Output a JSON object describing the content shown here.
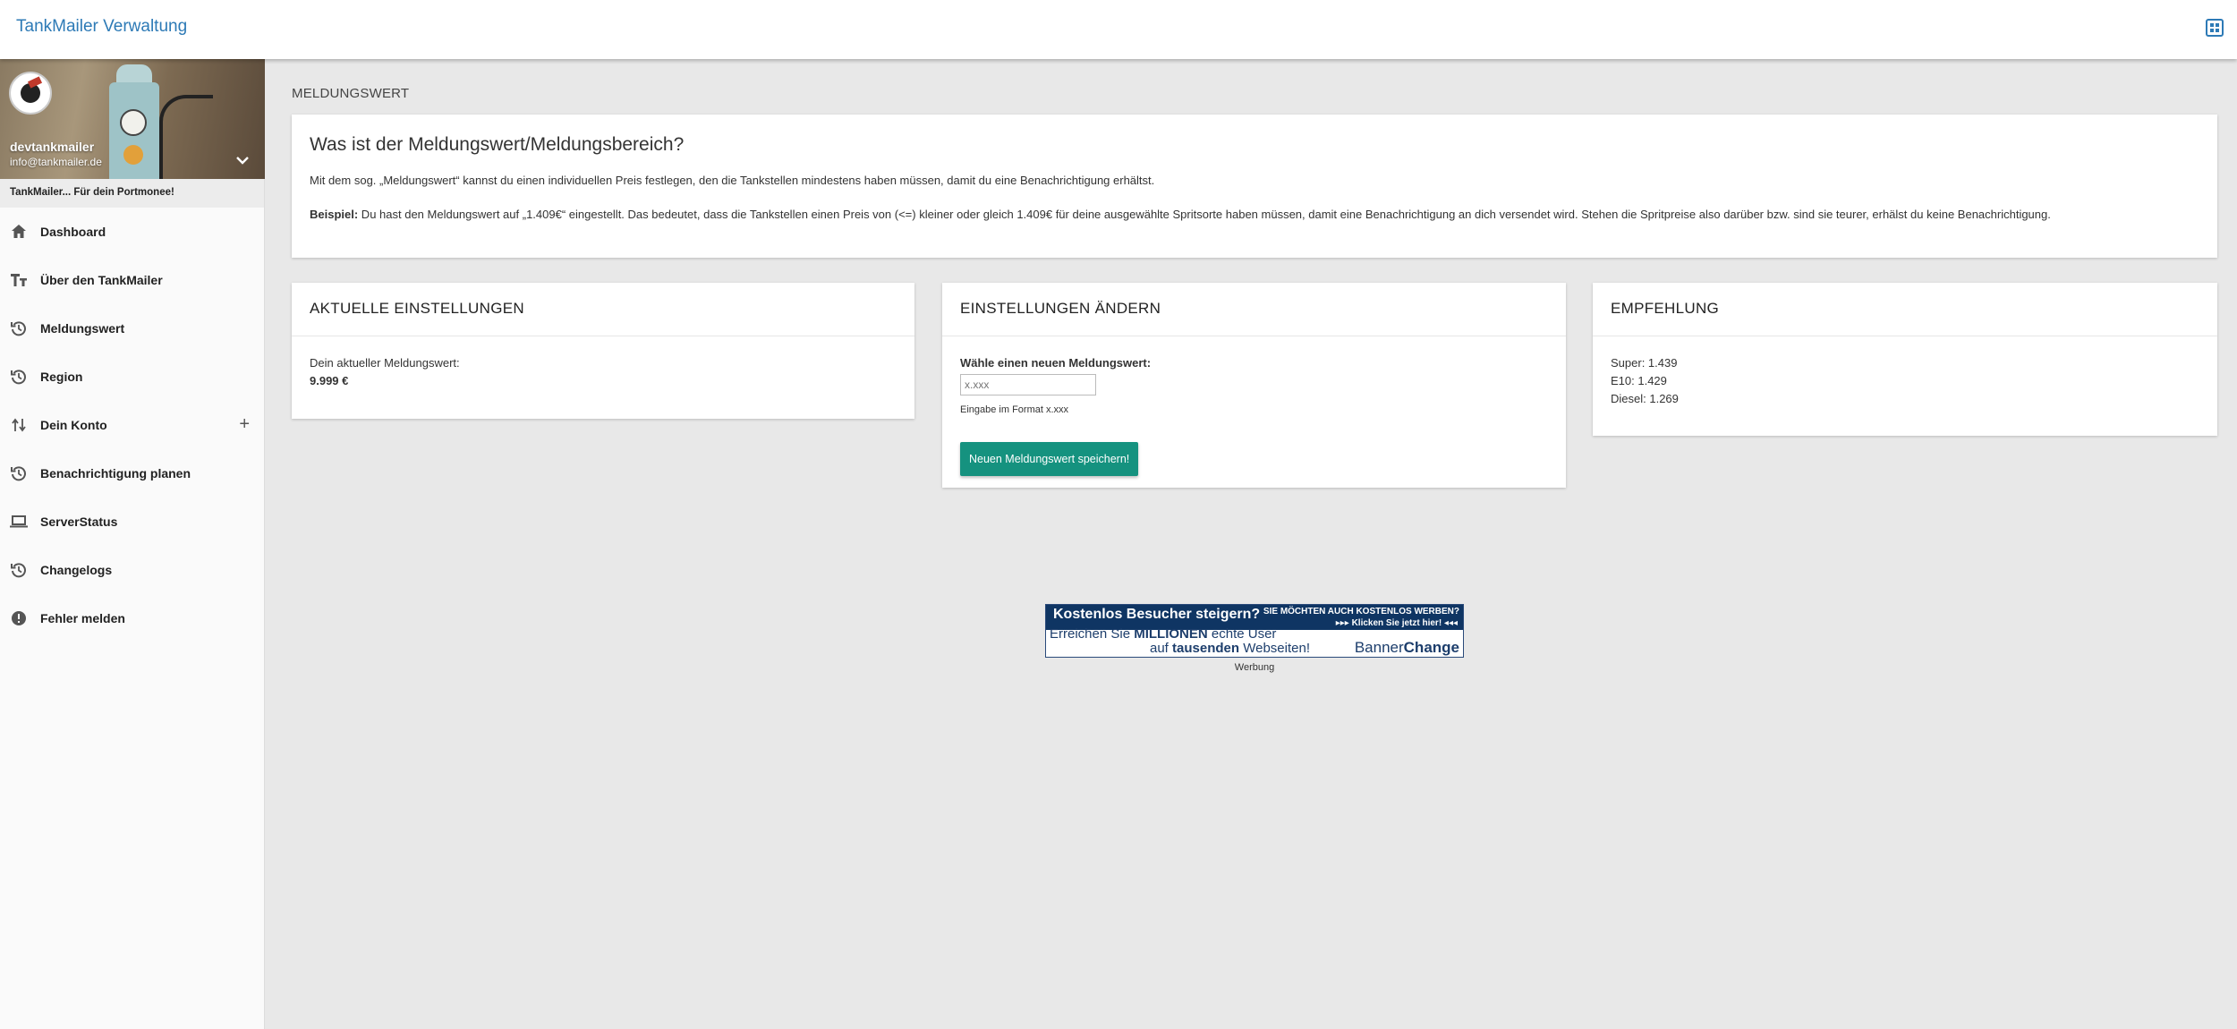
{
  "app": {
    "title": "TankMailer Verwaltung"
  },
  "profile": {
    "username": "devtankmailer",
    "email": "info@tankmailer.de",
    "slogan": "TankMailer... Für dein Portmonee!"
  },
  "sidebar": {
    "items": [
      {
        "label": "Dashboard",
        "icon": "home-icon"
      },
      {
        "label": "Über den TankMailer",
        "icon": "text-icon"
      },
      {
        "label": "Meldungswert",
        "icon": "history-icon"
      },
      {
        "label": "Region",
        "icon": "history-icon"
      },
      {
        "label": "Dein Konto",
        "icon": "swap-icon",
        "expand": "+"
      },
      {
        "label": "Benachrichtigung planen",
        "icon": "history-icon"
      },
      {
        "label": "ServerStatus",
        "icon": "laptop-icon"
      },
      {
        "label": "Changelogs",
        "icon": "history-icon"
      },
      {
        "label": "Fehler melden",
        "icon": "alert-icon"
      }
    ]
  },
  "page": {
    "breadcrumb": "MELDUNGSWERT",
    "intro": {
      "title": "Was ist der Meldungswert/Meldungsbereich?",
      "paragraph1": "Mit dem sog. „Meldungswert“ kannst du einen individuellen Preis festlegen, den die Tankstellen mindestens haben müssen, damit du eine Benachrichtigung erhältst.",
      "example_label": "Beispiel:",
      "example_text": " Du hast den Meldungswert auf „1.409€“ eingestellt. Das bedeutet, dass die Tankstellen einen Preis von (<=) kleiner oder gleich 1.409€ für deine ausgewählte Spritsorte haben müssen, damit eine Benachrichtigung an dich versendet wird. Stehen die Spritpreise also darüber bzw. sind sie teurer, erhälst du keine Benachrichtigung."
    },
    "current": {
      "title": "AKTUELLE EINSTELLUNGEN",
      "label": "Dein aktueller Meldungswert:",
      "value": "9.999 €"
    },
    "change": {
      "title": "EINSTELLUNGEN ÄNDERN",
      "label": "Wähle einen neuen Meldungswert:",
      "placeholder": "x.xxx",
      "hint": "Eingabe im Format x.xxx",
      "button": "Neuen Meldungswert speichern!"
    },
    "recommendation": {
      "title": "EMPFEHLUNG",
      "lines": [
        "Super: 1.439",
        "E10: 1.429",
        "Diesel: 1.269"
      ]
    }
  },
  "ad": {
    "line1": "Kostenlos Besucher steigern?",
    "right1": "SIE MÖCHTEN AUCH KOSTENLOS WERBEN?",
    "right2": "▸▸▸ Klicken Sie jetzt hier! ◂◂◂",
    "line2_a": "Erreichen Sie ",
    "line2_b": "MILLIONEN",
    "line2_c": " echte User",
    "line3_a": "auf ",
    "line3_b": "tausenden",
    "line3_c": " Webseiten!",
    "brand_a": "Banner",
    "brand_b": "Change",
    "label": "Werbung"
  },
  "colors": {
    "accent": "#15927f",
    "title_blue": "#2d7ab6"
  }
}
